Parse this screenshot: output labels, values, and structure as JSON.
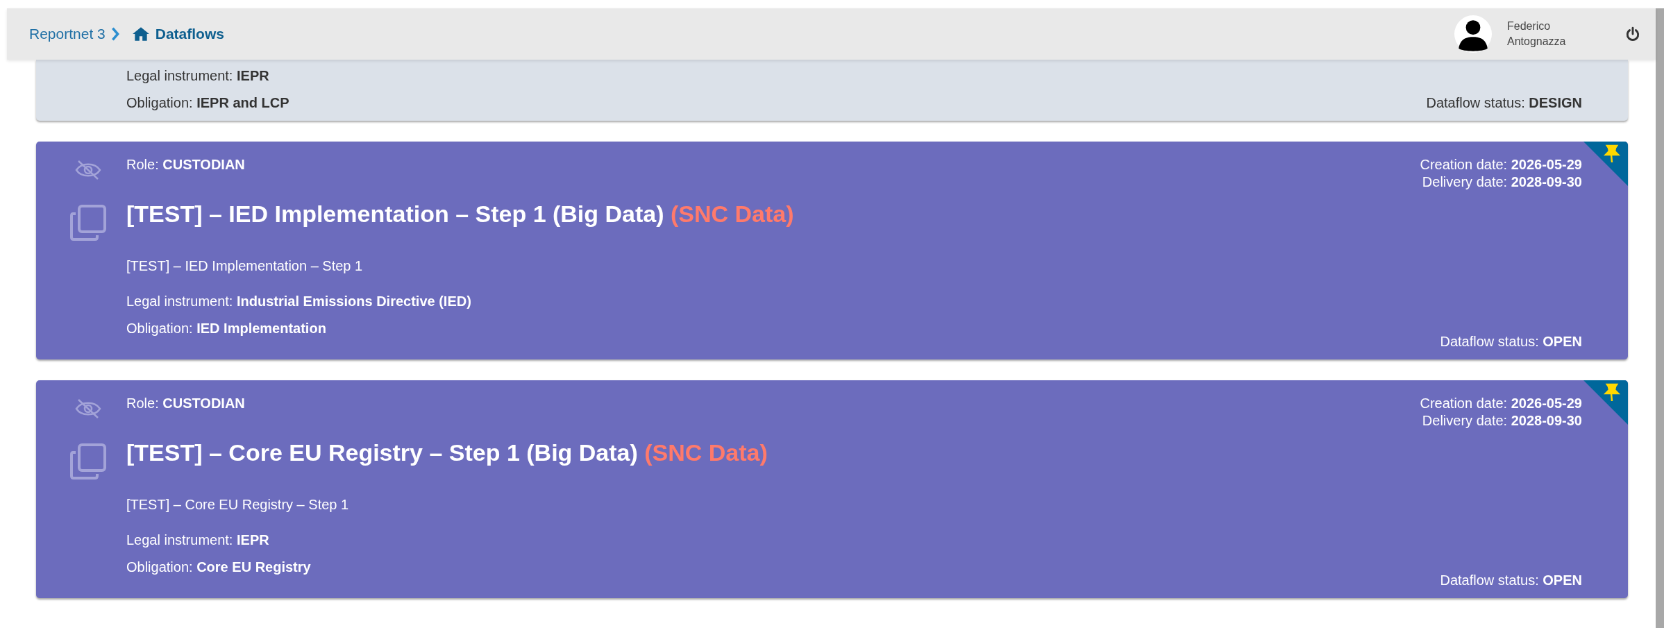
{
  "breadcrumb": [
    {
      "label": "Reportnet 3",
      "kind": "link"
    },
    {
      "label": "Dataflows",
      "kind": "current"
    }
  ],
  "user": {
    "name": "Federico Antognazza"
  },
  "dataflows": [
    {
      "kind": "design",
      "legal_instrument": "Legal instrument: **IEPR**",
      "obligation": "Obligation: **IEPR and LCP**",
      "status": "Dataflow status: **DESIGN**"
    },
    {
      "kind": "open",
      "pinned": true,
      "role": "Role: **CUSTODIAN**",
      "title": "[TEST] – IED Implementation – Step 1 (Big Data)",
      "tag": "(SNC Data)",
      "description": "[TEST] – IED Implementation – Step 1",
      "creation_date": "Creation date: **2026-05-29**",
      "delivery_date": "Delivery date: **2028-09-30**",
      "legal_instrument": "Legal instrument: **Industrial Emissions Directive (IED)**",
      "obligation": "Obligation: **IED Implementation**",
      "status": "Dataflow status: **OPEN**"
    },
    {
      "kind": "open",
      "pinned": true,
      "role": "Role: **CUSTODIAN**",
      "title": "[TEST] – Core EU Registry – Step 1 (Big Data)",
      "tag": "(SNC Data)",
      "description": "[TEST] – Core EU Registry – Step 1",
      "creation_date": "Creation date: **2026-05-29**",
      "delivery_date": "Delivery date: **2028-09-30**",
      "legal_instrument": "Legal instrument: **IEPR**",
      "obligation": "Obligation: **Core EU Registry**",
      "status": "Dataflow status: **OPEN**"
    }
  ]
}
